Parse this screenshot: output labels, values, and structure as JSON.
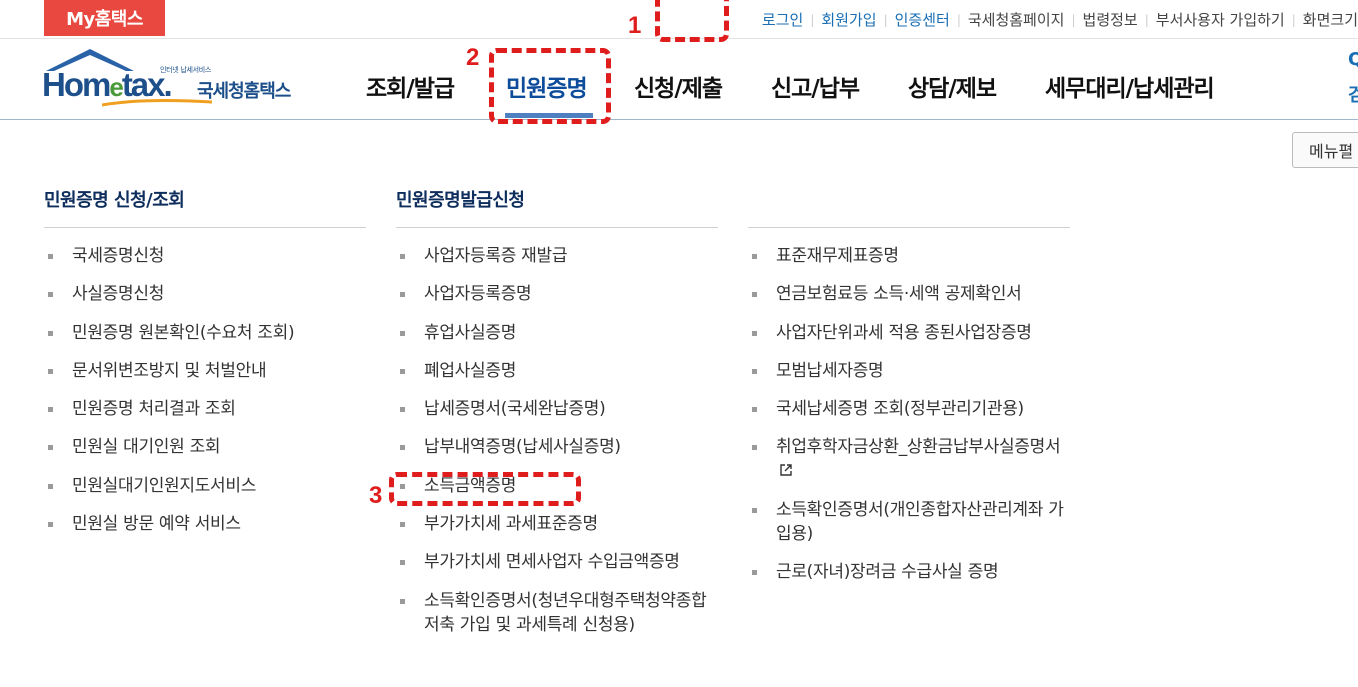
{
  "topbar": {
    "my_hometax": "My홈택스",
    "links": [
      {
        "label": "로그인",
        "style": "blue"
      },
      {
        "label": "회원가입",
        "style": "blue"
      },
      {
        "label": "인증센터",
        "style": "blue"
      },
      {
        "label": "국세청홈페이지",
        "style": "normal"
      },
      {
        "label": "법령정보",
        "style": "normal"
      },
      {
        "label": "부서사용자 가입하기",
        "style": "normal"
      },
      {
        "label": "화면크기",
        "style": "normal"
      }
    ]
  },
  "logo": {
    "small_text": "인터넷 납세서비스",
    "main_text_pre": "Hom",
    "main_text_e": "e",
    "main_text_post": "tax.",
    "korean_text": "국세청홈택스"
  },
  "gnb": {
    "items": [
      "조회/발급",
      "민원증명",
      "신청/제출",
      "신고/납부",
      "상담/제보",
      "세무대리/납세관리"
    ],
    "active_index": 1,
    "right_fragment_1": "Q",
    "right_fragment_2": "검"
  },
  "menu_button": "메뉴펼",
  "columns": [
    {
      "title": "민원증명 신청/조회",
      "items": [
        "국세증명신청",
        "사실증명신청",
        "민원증명 원본확인(수요처 조회)",
        "문서위변조방지 및 처벌안내",
        "민원증명 처리결과 조회",
        "민원실 대기인원 조회",
        "민원실대기인원지도서비스",
        "민원실 방문 예약 서비스"
      ]
    },
    {
      "title": "민원증명발급신청",
      "items": [
        "사업자등록증 재발급",
        "사업자등록증명",
        "휴업사실증명",
        "폐업사실증명",
        "납세증명서(국세완납증명)",
        "납부내역증명(납세사실증명)",
        "소득금액증명",
        "부가가치세 과세표준증명",
        "부가가치세 면세사업자 수입금액증명",
        "소득확인증명서(청년우대형주택청약종합저축 가입 및 과세특례 신청용)"
      ]
    },
    {
      "title": "",
      "items": [
        "표준재무제표증명",
        "연금보험료등 소득·세액 공제확인서",
        "사업자단위과세 적용 종된사업장증명",
        "모범납세자증명",
        "국세납세증명 조회(정부관리기관용)",
        "취업후학자금상환_상환금납부사실증명서",
        "소득확인증명서(개인종합자산관리계좌 가입용)",
        "근로(자녀)장려금 수급사실 증명"
      ]
    }
  ],
  "annotations": [
    {
      "number": "1",
      "target": "로그인"
    },
    {
      "number": "2",
      "target": "민원증명"
    },
    {
      "number": "3",
      "target": "소득금액증명"
    }
  ],
  "colors": {
    "my_hometax_bg": "#e8483f",
    "link_blue": "#1a6fb4",
    "active_menu": "#0d4c9b",
    "annotation_red": "#e01d1d",
    "column_title": "#0d2d5c"
  }
}
